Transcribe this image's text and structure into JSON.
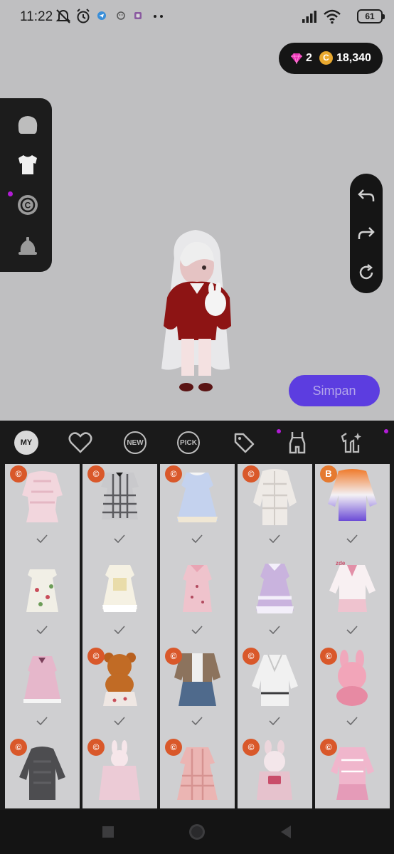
{
  "status_bar": {
    "time": "11:22",
    "battery": "61"
  },
  "currency": {
    "gems": "2",
    "coins": "18,340"
  },
  "left_panel": {
    "items": [
      "head-icon",
      "shirt-icon",
      "copyright-icon",
      "bell-icon"
    ]
  },
  "right_panel": {
    "buttons": [
      "undo-icon",
      "redo-icon",
      "reset-icon"
    ]
  },
  "save_button": {
    "label": "Simpan"
  },
  "tabs": [
    {
      "name": "tab-my",
      "label": "MY"
    },
    {
      "name": "tab-favorites",
      "icon": "heart-icon"
    },
    {
      "name": "tab-new",
      "label": "NEW"
    },
    {
      "name": "tab-pick",
      "label": "PICK"
    },
    {
      "name": "tab-sale",
      "icon": "tag-icon"
    },
    {
      "name": "tab-outfit",
      "icon": "dress-icon"
    },
    {
      "name": "tab-coordinate",
      "icon": "sparkle-outfit-icon"
    }
  ],
  "items_grid": {
    "badge_copyright": "©",
    "badge_b": "B",
    "colors": {
      "badge": "#d9582a",
      "accent": "#5c3de0",
      "notification_dot": "#b21cd6"
    }
  },
  "nav_bar": {
    "buttons": [
      "recent-apps-icon",
      "home-icon",
      "back-icon"
    ]
  }
}
